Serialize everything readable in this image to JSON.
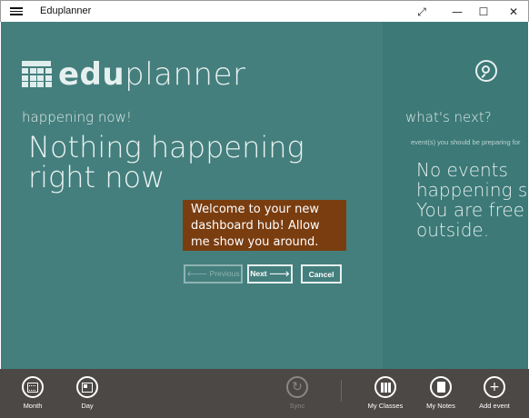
{
  "window": {
    "title": "Eduplanner",
    "controls": {
      "fullscreen": "⤢",
      "minimize": "—",
      "maximize": "☐",
      "close": "✕"
    }
  },
  "brand": {
    "bold": "edu",
    "light": "planner"
  },
  "happening": {
    "heading": "happening now!",
    "message": "Nothing happening right now"
  },
  "next": {
    "heading": "what's next?",
    "subheading": "event(s) you should be preparing for",
    "message_lines": [
      "No events",
      "happening s",
      "You are free",
      "outside."
    ]
  },
  "tour": {
    "message": "Welcome to your new dashboard hub! Allow me show you around.",
    "previous_label": "🡐 Previous",
    "next_label": "Next 🡒",
    "cancel_label": "Cancel"
  },
  "appbar": {
    "month": "Month",
    "day": "Day",
    "sync": "Sync",
    "my_classes": "My Classes",
    "my_notes": "My Notes",
    "add_event": "Add event"
  },
  "colors": {
    "main_bg": "#3f7d7b",
    "tooltip_bg": "#7a3d10",
    "appbar_bg": "#4b4846"
  }
}
